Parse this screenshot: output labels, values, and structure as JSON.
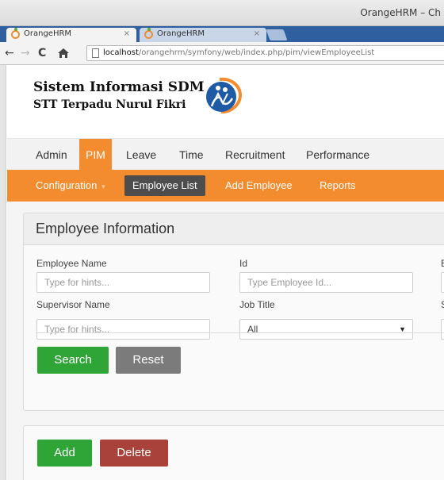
{
  "window": {
    "title": "OrangeHRM – Ch"
  },
  "tabs": [
    {
      "label": "OrangeHRM",
      "close": "×"
    },
    {
      "label": "OrangeHRM",
      "close": "×"
    }
  ],
  "address": {
    "host": "localhost",
    "path": "/orangehrm/symfony/web/index.php/pim/viewEmployeeList"
  },
  "branding": {
    "line1": "Sistem Informasi SDM",
    "line2": "STT Terpadu Nurul Fikri"
  },
  "main_menu": [
    "Admin",
    "PIM",
    "Leave",
    "Time",
    "Recruitment",
    "Performance"
  ],
  "sub_menu": {
    "configuration": "Configuration",
    "caret": "▼",
    "employee_list": "Employee List",
    "add_employee": "Add Employee",
    "reports": "Reports"
  },
  "employee_info": {
    "title": "Employee Information",
    "employee_name_label": "Employee Name",
    "employee_name_placeholder": "Type for hints...",
    "id_label": "Id",
    "id_placeholder": "Type Employee Id...",
    "col3_label_fragment": "E",
    "supervisor_label": "Supervisor Name",
    "supervisor_placeholder": "Type for hints...",
    "job_title_label": "Job Title",
    "job_title_value": "All",
    "col3_label2_fragment": "S",
    "search_button": "Search",
    "reset_button": "Reset"
  },
  "actions": {
    "add_button": "Add",
    "delete_button": "Delete"
  },
  "colors": {
    "accent": "#f28c2e",
    "search_green": "#2fa437",
    "delete_red": "#a8423a",
    "tab_bar": "#2f5f9e"
  }
}
